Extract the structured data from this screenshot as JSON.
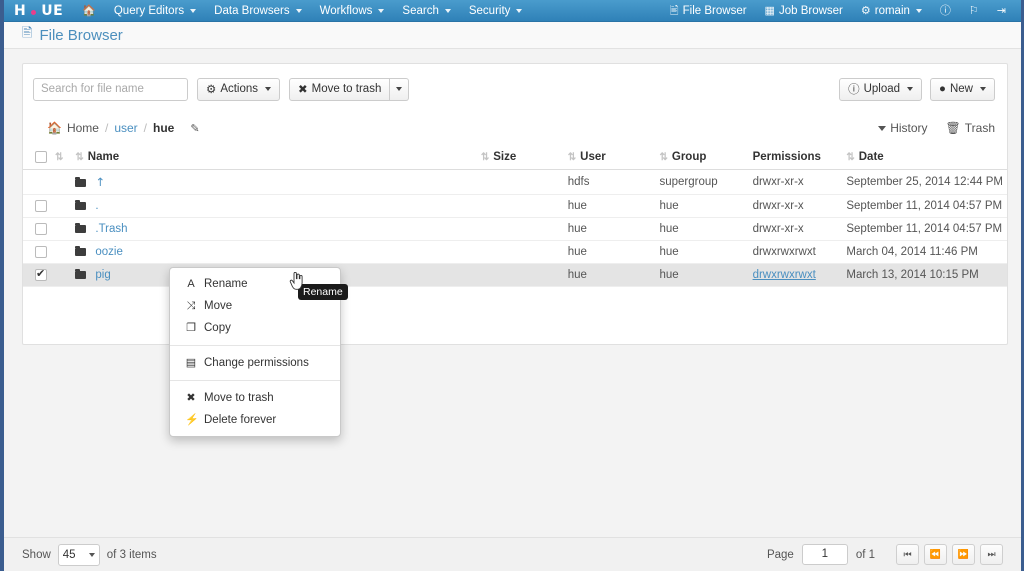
{
  "navbar": {
    "brand": "hue",
    "brand_parts": {
      "left": "H",
      "right": "UE"
    },
    "home_icon": "home-icon",
    "left_items": [
      {
        "label": "Query Editors",
        "caret": true
      },
      {
        "label": "Data Browsers",
        "caret": true
      },
      {
        "label": "Workflows",
        "caret": true
      },
      {
        "label": "Search",
        "caret": true
      },
      {
        "label": "Security",
        "caret": true
      }
    ],
    "right_items": [
      {
        "label": "File Browser",
        "icon": "file-icon"
      },
      {
        "label": "Job Browser",
        "icon": "window-icon"
      },
      {
        "label": "romain",
        "icon": "gears-icon",
        "caret": true
      }
    ],
    "right_icons": [
      {
        "name": "help-icon",
        "glyph": "?"
      },
      {
        "name": "flag-icon",
        "glyph": "⚑"
      },
      {
        "name": "logout-icon",
        "glyph": "⇥"
      }
    ]
  },
  "heading": {
    "icon": "file-document-icon",
    "title": "File Browser"
  },
  "toolbar": {
    "search_placeholder": "Search for file name",
    "search_value": "",
    "actions_label": "Actions",
    "move_to_trash_label": "Move to trash",
    "upload_label": "Upload",
    "new_label": "New"
  },
  "breadcrumb": {
    "home_label": "Home",
    "separator": "/",
    "items": [
      {
        "label": "user",
        "current": false
      },
      {
        "label": "hue",
        "current": true
      }
    ],
    "edit_icon": "pencil-icon",
    "history_label": "History",
    "trash_label": "Trash"
  },
  "table": {
    "headers": {
      "name": "Name",
      "size": "Size",
      "user": "User",
      "group": "Group",
      "permissions": "Permissions",
      "date": "Date"
    },
    "rows": [
      {
        "checkbox": "none",
        "selected": false,
        "icon": "folder-icon",
        "name": "↑",
        "name_is_parent": true,
        "size": "",
        "user": "hdfs",
        "group": "supergroup",
        "permissions": "drwxr-xr-x",
        "permissions_link": false,
        "date": "September 25, 2014 12:44 PM"
      },
      {
        "checkbox": "unchecked",
        "selected": false,
        "icon": "folder-icon",
        "name": ".",
        "name_is_parent": false,
        "size": "",
        "user": "hue",
        "group": "hue",
        "permissions": "drwxr-xr-x",
        "permissions_link": false,
        "date": "September 11, 2014 04:57 PM"
      },
      {
        "checkbox": "unchecked",
        "selected": false,
        "icon": "folder-icon",
        "name": ".Trash",
        "name_is_parent": false,
        "size": "",
        "user": "hue",
        "group": "hue",
        "permissions": "drwxr-xr-x",
        "permissions_link": false,
        "date": "September 11, 2014 04:57 PM"
      },
      {
        "checkbox": "unchecked",
        "selected": false,
        "icon": "folder-icon",
        "name": "oozie",
        "name_is_parent": false,
        "size": "",
        "user": "hue",
        "group": "hue",
        "permissions": "drwxrwxrwxt",
        "permissions_link": false,
        "date": "March 04, 2014 11:46 PM"
      },
      {
        "checkbox": "checked",
        "selected": true,
        "icon": "folder-icon",
        "name": "pig",
        "name_is_parent": false,
        "size": "",
        "user": "hue",
        "group": "hue",
        "permissions": "drwxrwxrwxt",
        "permissions_link": true,
        "date": "March 13, 2014 10:15 PM"
      }
    ]
  },
  "context_menu": {
    "items": [
      {
        "label": "Rename",
        "icon": "text-cursor-icon",
        "glyph": "A",
        "highlighted": true
      },
      {
        "label": "Move",
        "icon": "shuffle-icon",
        "glyph": "⤨"
      },
      {
        "label": "Copy",
        "icon": "copy-icon",
        "glyph": "❐"
      },
      {
        "divider": true
      },
      {
        "label": "Change permissions",
        "icon": "permissions-icon",
        "glyph": "▤"
      },
      {
        "divider": true
      },
      {
        "label": "Move to trash",
        "icon": "remove-icon",
        "glyph": "✖"
      },
      {
        "label": "Delete forever",
        "icon": "bolt-icon",
        "glyph": "⚡"
      }
    ]
  },
  "tooltip": {
    "text": "Rename"
  },
  "cursor": {
    "type": "pointing-hand"
  },
  "footer": {
    "show_label": "Show",
    "page_size": "45",
    "items_label": "of 3 items",
    "page_label": "Page",
    "page_value": "1",
    "page_total": "of 1",
    "nav_buttons": [
      {
        "name": "first-page",
        "glyph": "⏮"
      },
      {
        "name": "prev-page",
        "glyph": "⏪"
      },
      {
        "name": "next-page",
        "glyph": "⏩"
      },
      {
        "name": "last-page",
        "glyph": "⏭"
      }
    ]
  },
  "colors": {
    "navbar": "#388bc0",
    "link": "#4a8fc0",
    "accent_dot": "#e83e8c",
    "frame": "#3b5d8f",
    "selected_row": "#e4e4e4"
  }
}
